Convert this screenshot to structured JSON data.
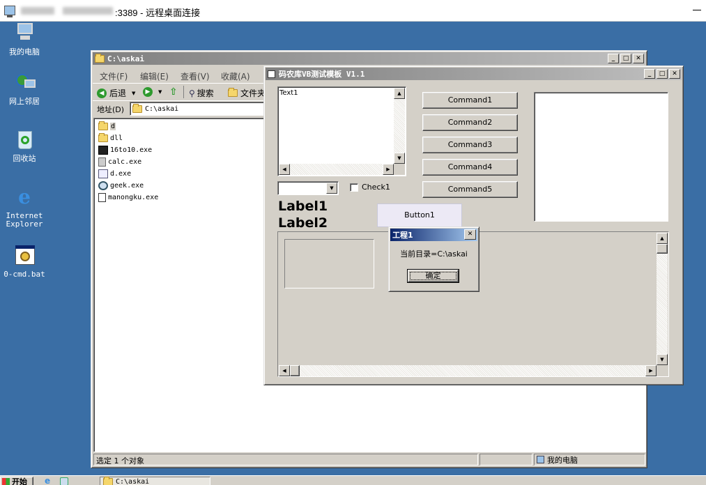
{
  "rdp": {
    "title_suffix": ":3389 - 远程桌面连接"
  },
  "desktop": {
    "icons": [
      {
        "label": "我的电脑",
        "icon": "my-computer-icon"
      },
      {
        "label": "网上邻居",
        "icon": "network-icon"
      },
      {
        "label": "回收站",
        "icon": "recycle-bin-icon"
      },
      {
        "label1": "Internet",
        "label2": "Explorer",
        "icon": "ie-icon"
      },
      {
        "label": "0-cmd.bat",
        "icon": "batch-file-icon"
      }
    ]
  },
  "explorer": {
    "title": "C:\\askai",
    "menu": [
      "文件(F)",
      "编辑(E)",
      "查看(V)",
      "收藏(A)"
    ],
    "toolbar": {
      "back": "后退",
      "search": "搜索",
      "folders": "文件夹"
    },
    "address": {
      "label": "地址(D)",
      "value": "C:\\askai"
    },
    "files": [
      {
        "name": "d",
        "icon": "folder-icon"
      },
      {
        "name": "dll",
        "icon": "folder-icon"
      },
      {
        "name": "16to10.exe",
        "icon": "exe-icon"
      },
      {
        "name": "calc.exe",
        "icon": "calculator-icon"
      },
      {
        "name": "d.exe",
        "icon": "exe-icon"
      },
      {
        "name": "geek.exe",
        "icon": "geek-icon"
      },
      {
        "name": "manongku.exe",
        "icon": "exe-icon"
      }
    ],
    "status": {
      "selection": "选定 1 个对象",
      "location": "我的电脑"
    }
  },
  "vbform": {
    "title": "码农库VB测试模板 V1.1",
    "textbox": "Text1",
    "commands": [
      "Command1",
      "Command2",
      "Command3",
      "Command4",
      "Command5"
    ],
    "checkbox": "Check1",
    "label1": "Label1",
    "label2": "Label2",
    "button1": "Button1"
  },
  "dialog": {
    "title": "工程1",
    "message": "当前目录=C:\\askai",
    "ok": "确定"
  },
  "taskbar": {
    "start": "开始",
    "task": "C:\\askai"
  },
  "colors": {
    "desktop": "#3a6ea5",
    "face": "#d4d0c8",
    "active_title": "#0a246a"
  }
}
